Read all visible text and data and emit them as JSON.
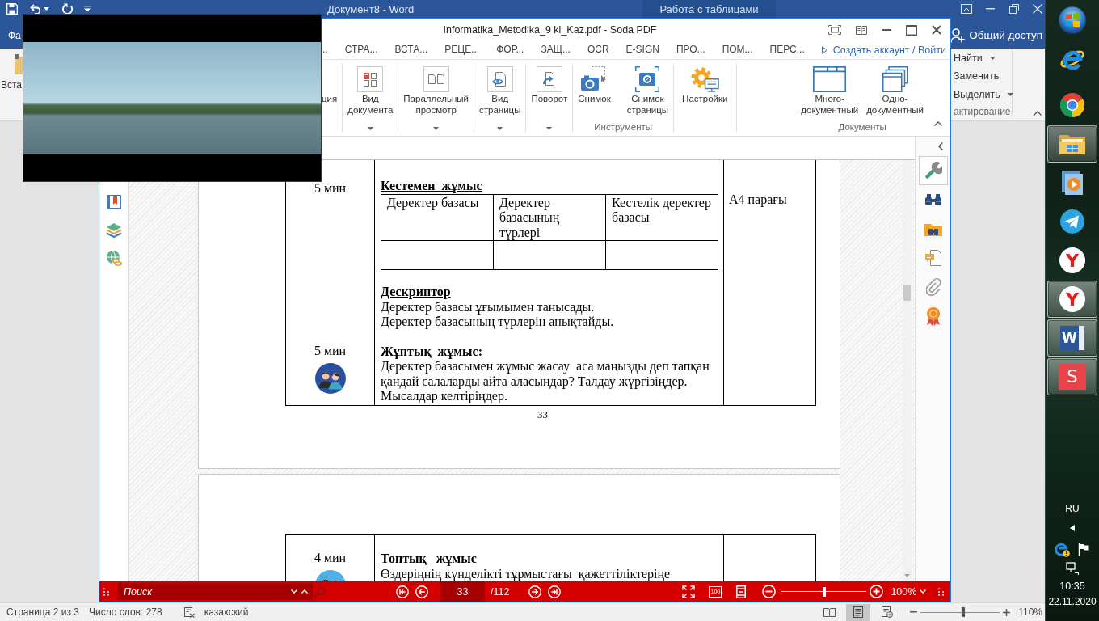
{
  "word_window": {
    "title": "Документ8 - Word",
    "context_tab": "Работа с таблицами",
    "file_tab": "Фа",
    "share_button": "Общий доступ",
    "ribbon": {
      "paste_label": "Вста",
      "editing": [
        {
          "label": "Найти",
          "dropdown": true
        },
        {
          "label": "Заменить",
          "dropdown": false
        },
        {
          "label": "Выделить",
          "dropdown": true
        }
      ],
      "editing_group": "актирование"
    },
    "status_bar": {
      "page": "Страница 2 из 3",
      "words": "Число слов: 278",
      "language": "казахский",
      "views": [
        {
          "selected": false
        },
        {
          "selected": true
        },
        {
          "selected": false
        }
      ],
      "zoom_slider": {
        "level": 0.54
      },
      "zoom": "110%"
    }
  },
  "soda_window": {
    "title": "Informatika_Metodika_9 kl_Kaz.pdf - Soda PDF",
    "tabs": [
      {
        "label": "..",
        "selected": false
      },
      {
        "label": "СТРА...",
        "selected": false
      },
      {
        "label": "ВСТА...",
        "selected": false
      },
      {
        "label": "РЕЦЕ...",
        "selected": false
      },
      {
        "label": "ФОР...",
        "selected": false
      },
      {
        "label": "ЗАЩ...",
        "selected": false
      },
      {
        "label": "OCR",
        "selected": false
      },
      {
        "label": "E-SIGN",
        "selected": false
      },
      {
        "label": "ПРО...",
        "selected": false
      },
      {
        "label": "ПОМ...",
        "selected": false
      },
      {
        "label": "ПЕРС...",
        "selected": false
      }
    ],
    "account_link": "Создать аккаунт / Войти",
    "ribbon": [
      {
        "buttons": [
          {
            "label": "ция",
            "dropdown": false
          }
        ]
      },
      {
        "buttons": [
          {
            "label": "Вид документа",
            "dropdown": true
          }
        ]
      },
      {
        "buttons": [
          {
            "label": "Параллельный просмотр",
            "dropdown": true
          }
        ]
      },
      {
        "buttons": [
          {
            "label": "Вид страницы",
            "dropdown": true
          }
        ]
      },
      {
        "buttons": [
          {
            "label": "Поворот",
            "dropdown": true
          }
        ]
      },
      {
        "label": "Инструменты",
        "buttons": [
          {
            "label": "Снимок",
            "dropdown": false
          },
          {
            "label": "Снимок страницы",
            "dropdown": false
          }
        ]
      },
      {
        "buttons": [
          {
            "label": "Настройки",
            "dropdown": false
          }
        ]
      },
      {
        "label": "Документы",
        "buttons": [
          {
            "label": "Много-документный",
            "dropdown": false
          },
          {
            "label": "Одно-документный",
            "dropdown": false
          }
        ]
      }
    ],
    "pages": [
      {
        "sections": [
          {
            "time": "5 мин",
            "heading": "Кестемен  жұмыс",
            "table": {
              "columns": [
                "Деректер базасы",
                "Деректер базасының түрлері",
                "Кестелік деректер базасы"
              ],
              "blank_row": true
            }
          },
          {
            "heading": "Дескриптор",
            "lines": [
              "Деректер базасы ұғымымен танысады.",
              "Деректер базасының түрлерін анықтайды."
            ]
          },
          {
            "time": "5 мин",
            "avatar": true,
            "heading": "Жұптық  жұмыс:",
            "lines": [
              "Деректер базасымен жұмыс жасау  аса маңызды деп тапқан қандай салаларды айта аласыңдар? Талдау жүргізіңдер. Мысалдар келтіріңдер."
            ]
          }
        ],
        "resource": "A4 парағы",
        "page_number": "33"
      },
      {
        "sections": [
          {
            "time": "4 мин",
            "avatar": true,
            "heading": "Топтық   жұмыс",
            "lines": [
              "Өздеріңнің күнделікті тұрмыстағы  қажеттіліктеріңе"
            ]
          }
        ]
      }
    ],
    "side_tools": [
      {
        "selected": true
      },
      {
        "selected": false
      },
      {
        "selected": false
      },
      {
        "selected": false
      },
      {
        "selected": false
      },
      {
        "selected": false
      }
    ],
    "toolbar": {
      "search": {
        "placeholder": "Поиск"
      },
      "page": "33",
      "page_total": "/112",
      "actual_size": "100",
      "zoom_slider": {
        "level": 0.5
      },
      "zoom": "100%"
    }
  },
  "taskbar": {
    "apps": [
      {
        "running": false
      },
      {
        "running": false
      },
      {
        "running": true
      },
      {
        "running": false
      },
      {
        "running": false
      },
      {
        "running": false,
        "glyph": "Y"
      },
      {
        "running": true,
        "glyph": "Y"
      },
      {
        "running": true,
        "glyph": "W"
      },
      {
        "running": true,
        "glyph": "S"
      }
    ],
    "language": "RU",
    "time": "10:35",
    "date": "22.11.2020"
  }
}
